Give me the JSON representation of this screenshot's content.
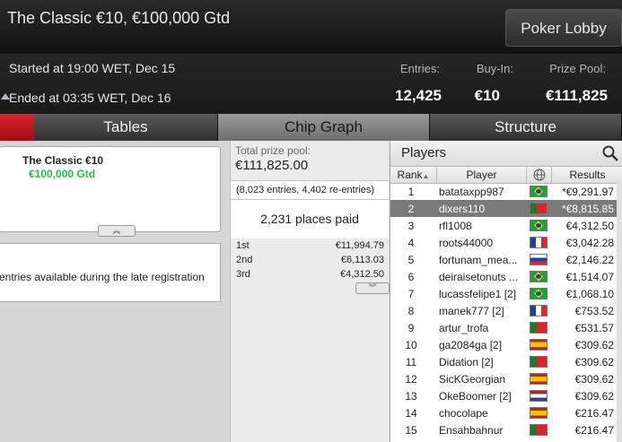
{
  "window": {
    "title": "The Classic €10, €100,000 Gtd",
    "lobby_button": "Poker Lobby"
  },
  "info": {
    "started": "Started at 19:00 WET, Dec 15",
    "ended": "Ended at 03:35 WET, Dec 16",
    "entries_label": "Entries:",
    "entries_value": "12,425",
    "buyin_label": "Buy-In:",
    "buyin_value": "€10",
    "prize_label": "Prize Pool:",
    "prize_value": "€111,825"
  },
  "tabs": [
    {
      "label": "Tables"
    },
    {
      "label": "Chip Graph"
    },
    {
      "label": "Structure"
    }
  ],
  "card": {
    "name": "The Classic €10",
    "gtd": "€100,000 Gtd",
    "collapse_glyph": "︽"
  },
  "note": "entries available during the late registration",
  "prize": {
    "pool_label": "Total prize pool:",
    "pool_value": "€111,825.00",
    "entries_text": "(8,023 entries, 4,402 re-entries)",
    "places_text": "2,231 places paid",
    "places": [
      {
        "place": "1st",
        "amount": "€11,994.79"
      },
      {
        "place": "2nd",
        "amount": "€6,113.03"
      },
      {
        "place": "3rd",
        "amount": "€4,312.50"
      }
    ],
    "expand_glyph": "︾"
  },
  "players": {
    "title": "Players",
    "columns": {
      "rank": "Rank",
      "player": "Player",
      "results": "Results"
    },
    "rows": [
      {
        "rank": "1",
        "name": "batataxpp987",
        "flag": "br",
        "result": "*€9,291.97"
      },
      {
        "rank": "2",
        "name": "dixers110",
        "flag": "pt",
        "result": "*€8,815.85",
        "selected": true
      },
      {
        "rank": "3",
        "name": "rfl1008",
        "flag": "br",
        "result": "€4,312.50"
      },
      {
        "rank": "4",
        "name": "roots44000",
        "flag": "fr",
        "result": "€3,042.28"
      },
      {
        "rank": "5",
        "name": "fortunam_mea...",
        "flag": "ru",
        "result": "€2,146.22"
      },
      {
        "rank": "6",
        "name": "deiraisetonuts ...",
        "flag": "br",
        "result": "€1,514.07"
      },
      {
        "rank": "7",
        "name": "lucassfelipe1 [2]",
        "flag": "br",
        "result": "€1,068.10"
      },
      {
        "rank": "8",
        "name": "manek777 [2]",
        "flag": "fr",
        "result": "€753.52"
      },
      {
        "rank": "9",
        "name": "artur_trofa",
        "flag": "pt",
        "result": "€531.57"
      },
      {
        "rank": "10",
        "name": "ga2084ga [2]",
        "flag": "es",
        "result": "€309.62"
      },
      {
        "rank": "11",
        "name": "Didation [2]",
        "flag": "pt",
        "result": "€309.62"
      },
      {
        "rank": "12",
        "name": "SicKGeorgian",
        "flag": "es",
        "result": "€309.62"
      },
      {
        "rank": "13",
        "name": "OkeBoomer [2]",
        "flag": "nl",
        "result": "€309.62"
      },
      {
        "rank": "14",
        "name": "chocolape",
        "flag": "es",
        "result": "€216.47"
      },
      {
        "rank": "15",
        "name": "Ensahbahnur",
        "flag": "pt",
        "result": "€216.47"
      }
    ]
  }
}
